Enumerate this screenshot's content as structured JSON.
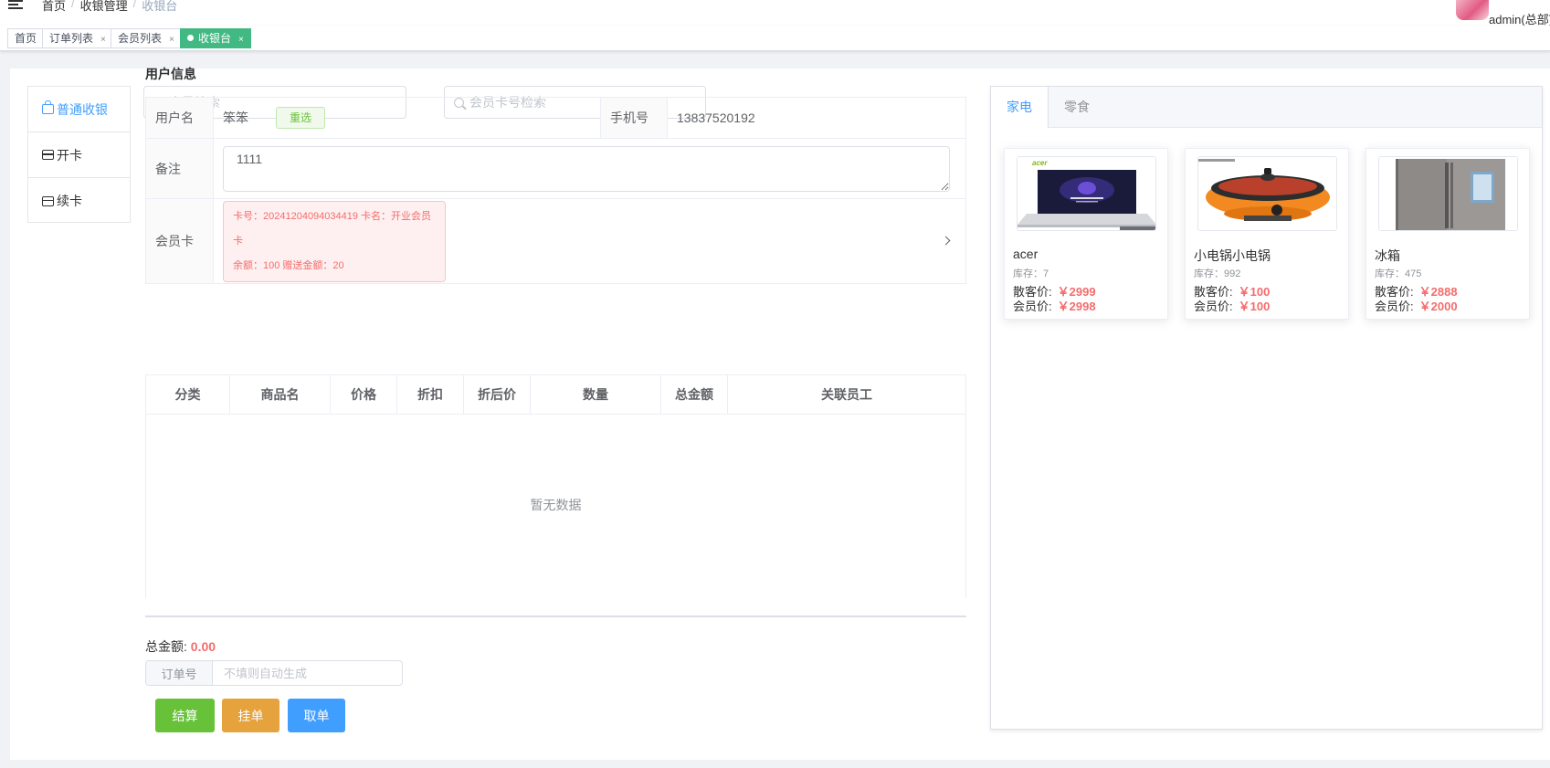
{
  "breadcrumb": [
    "首页",
    "收银管理",
    "收银台"
  ],
  "user": {
    "name": "admin(总部)"
  },
  "tags": [
    {
      "label": "首页"
    },
    {
      "label": "订单列表"
    },
    {
      "label": "会员列表"
    },
    {
      "label": "收银台"
    }
  ],
  "side_menu": [
    "普通收银",
    "开卡",
    "续卡"
  ],
  "search": {
    "member_placeholder": "会员检索",
    "card_placeholder": "会员卡号检索"
  },
  "user_info": {
    "title": "用户信息",
    "username_label": "用户名",
    "username": "笨笨",
    "reset_label": "重选",
    "phone_label": "手机号",
    "phone": "13837520192",
    "remark_label": "备注",
    "remark": "1111",
    "card_label": "会员卡",
    "card_line1": "卡号：20241204094034419 卡名：开业会员卡",
    "card_line2": "余额：100 赠送金额：20"
  },
  "table": {
    "columns": [
      "分类",
      "商品名",
      "价格",
      "折扣",
      "折后价",
      "数量",
      "总金额",
      "关联员工"
    ],
    "empty_text": "暂无数据"
  },
  "footer": {
    "total_label": "总金额:",
    "total_value": "0.00",
    "order_label": "订单号",
    "order_placeholder": "不填则自动生成",
    "checkout": "结算",
    "hold": "挂单",
    "retrieve": "取单"
  },
  "colors": {
    "success": "#67c23a",
    "warning": "#e6a23c",
    "primary": "#409eff",
    "danger": "#f56c6c",
    "tag_active": "#42b983"
  },
  "category_tabs": [
    "家电",
    "零食"
  ],
  "products": [
    {
      "name": "acer",
      "stock": "库存：7",
      "retail_label": "散客价:",
      "retail": "￥2999",
      "member_label": "会员价:",
      "member": "￥2998",
      "image": "laptop"
    },
    {
      "name": "小电锅小电锅",
      "stock": "库存：992",
      "retail_label": "散客价:",
      "retail": "￥100",
      "member_label": "会员价:",
      "member": "￥100",
      "image": "hotpot"
    },
    {
      "name": "冰箱",
      "stock": "库存：475",
      "retail_label": "散客价:",
      "retail": "￥2888",
      "member_label": "会员价:",
      "member": "￥2000",
      "image": "fridge"
    }
  ]
}
